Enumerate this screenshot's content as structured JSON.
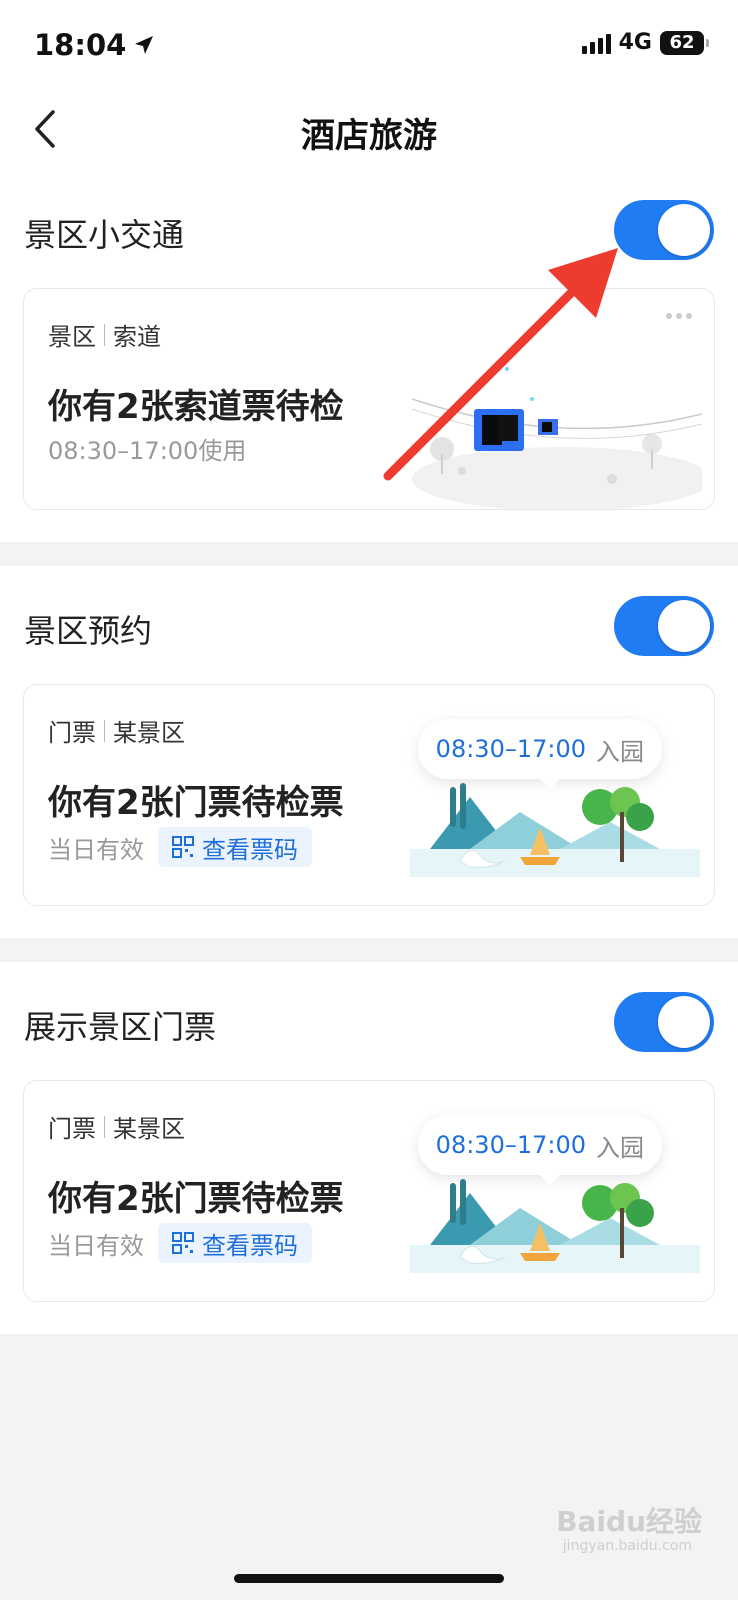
{
  "status_bar": {
    "time": "18:04",
    "network": "4G",
    "battery": "62"
  },
  "nav": {
    "title": "酒店旅游"
  },
  "sections": [
    {
      "label": "景区小交通",
      "enabled": true,
      "card": {
        "tag1": "景区",
        "tag2": "索道",
        "headline": "你有2张索道票待检",
        "sub": "08:30–17:00使用"
      }
    },
    {
      "label": "景区预约",
      "enabled": true,
      "card": {
        "tag1": "门票",
        "tag2": "某景区",
        "headline": "你有2张门票待检票",
        "validity": "当日有效",
        "qr_label": "查看票码",
        "bubble_time": "08:30–17:00",
        "bubble_label": "入园"
      }
    },
    {
      "label": "展示景区门票",
      "enabled": true,
      "card": {
        "tag1": "门票",
        "tag2": "某景区",
        "headline": "你有2张门票待检票",
        "validity": "当日有效",
        "qr_label": "查看票码",
        "bubble_time": "08:30–17:00",
        "bubble_label": "入园"
      }
    }
  ],
  "watermark": {
    "text": "Baidu经验",
    "sub": "jingyan.baidu.com"
  },
  "colors": {
    "accent": "#1f7cf3",
    "link": "#1f6fd9",
    "annotation_arrow": "#ee3b2f"
  },
  "icons": [
    "location-arrow-icon",
    "signal-icon",
    "battery-icon",
    "back-chevron-icon",
    "more-dots-icon",
    "qr-code-icon",
    "red-arrow-annotation"
  ]
}
